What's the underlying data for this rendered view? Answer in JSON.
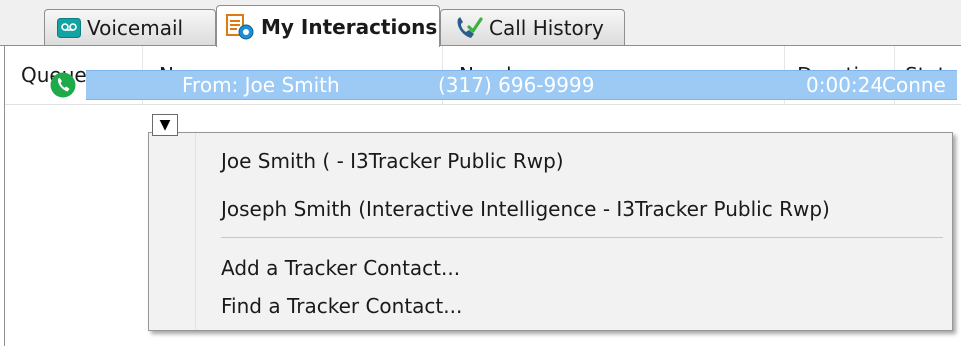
{
  "tabs": [
    {
      "label": "Voicemail",
      "icon": "voicemail-icon",
      "selected": false
    },
    {
      "label": "My Interactions",
      "icon": "interactions-icon",
      "selected": true
    },
    {
      "label": "Call History",
      "icon": "call-history-icon",
      "selected": false
    }
  ],
  "columns": {
    "queue": "Queue",
    "name": "Name",
    "number": "Number",
    "duration": "Duration",
    "state": "State"
  },
  "row": {
    "name": "From: Joe Smith",
    "number": "(317) 696-9999",
    "duration": "0:00:24",
    "state": "Conne",
    "status_icon": "phone-connected-icon",
    "dropdown_glyph": "▼"
  },
  "menu": {
    "items": [
      "Joe Smith ( - I3Tracker Public Rwp)",
      "Joseph Smith  (Interactive Intelligence - I3Tracker Public Rwp)",
      "Add a Tracker Contact...",
      "Find a Tracker Contact..."
    ]
  },
  "colors": {
    "selection": "#9ccaf5",
    "phone_green": "#1faa4a",
    "voicemail_teal": "#13a3a3",
    "tab_border": "#8e8f8f"
  }
}
